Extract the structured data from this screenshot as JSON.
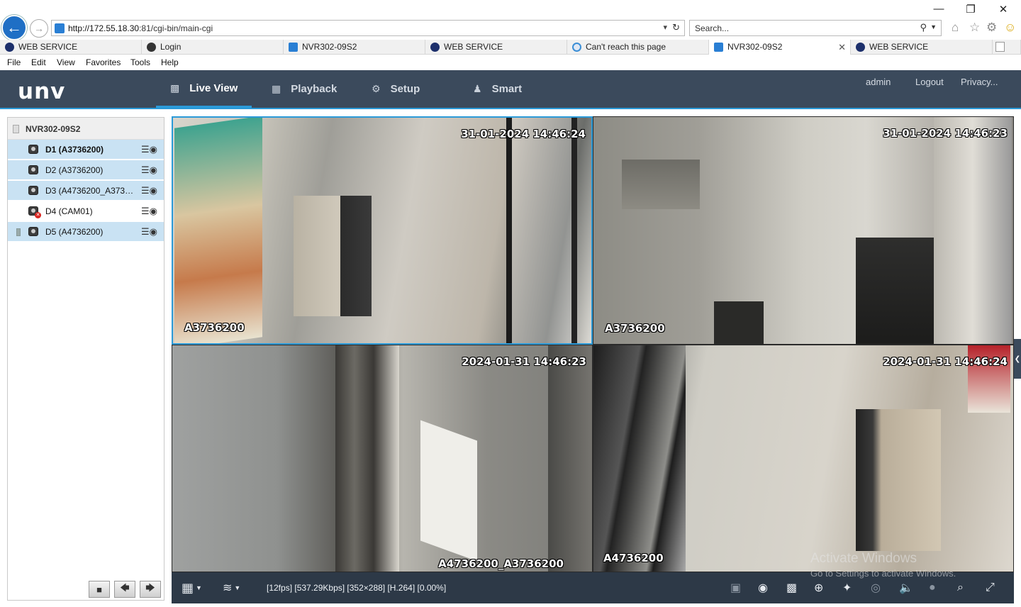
{
  "browser": {
    "url_host": "http://172.55.18.30",
    "url_rest": ":81/cgi-bin/main-cgi",
    "search_placeholder": "Search...",
    "tabs": [
      {
        "label": "WEB SERVICE",
        "icon": "globe-icon",
        "active": false
      },
      {
        "label": "Login",
        "icon": "globe-icon",
        "active": false
      },
      {
        "label": "NVR302-09S2",
        "icon": "page-icon",
        "active": false
      },
      {
        "label": "WEB SERVICE",
        "icon": "globe-icon",
        "active": false
      },
      {
        "label": "Can't reach this page",
        "icon": "ie-icon",
        "active": false
      },
      {
        "label": "NVR302-09S2",
        "icon": "page-icon",
        "active": true
      },
      {
        "label": "WEB SERVICE",
        "icon": "globe-icon",
        "active": false
      }
    ],
    "menu": [
      "File",
      "Edit",
      "View",
      "Favorites",
      "Tools",
      "Help"
    ]
  },
  "app": {
    "logo": "unv",
    "nav": [
      {
        "label": "Live View",
        "icon": "monitor-icon",
        "active": true
      },
      {
        "label": "Playback",
        "icon": "film-icon",
        "active": false
      },
      {
        "label": "Setup",
        "icon": "gear-icon",
        "active": false
      },
      {
        "label": "Smart",
        "icon": "person-icon",
        "active": false
      }
    ],
    "user": "admin",
    "logout": "Logout",
    "privacy": "Privacy..."
  },
  "sidebar": {
    "device": "NVR302-09S2",
    "cameras": [
      {
        "label": "D1 (A3736200)",
        "selected": true,
        "bold": true,
        "error": false
      },
      {
        "label": "D2 (A3736200)",
        "selected": true,
        "bold": false,
        "error": false
      },
      {
        "label": "D3 (A4736200_A3736200)",
        "selected": true,
        "bold": false,
        "error": false
      },
      {
        "label": "D4 (CAM01)",
        "selected": false,
        "bold": false,
        "error": true
      },
      {
        "label": "D5 (A4736200)",
        "selected": true,
        "bold": false,
        "error": false
      }
    ],
    "controls": [
      "stop-icon",
      "prev-icon",
      "next-icon"
    ]
  },
  "video": {
    "tiles": [
      {
        "timestamp": "31-01-2024 14:46:24",
        "osd": "A3736200"
      },
      {
        "timestamp": "31-01-2024 14:46:23",
        "osd": "A3736200"
      },
      {
        "timestamp": "2024-01-31 14:46:23",
        "osd": "A4736200_A3736200"
      },
      {
        "timestamp": "2024-01-31 14:46:24",
        "osd": "A4736200"
      }
    ]
  },
  "toolbar": {
    "stream_info": "[12fps] [537.29Kbps] [352×288] [H.264] [0.00%]",
    "buttons": [
      "layout-grid-icon",
      "stream-icon",
      "screen-icon",
      "snapshot-icon",
      "clip-icon",
      "zoom-icon",
      "ptz-icon",
      "focus-icon",
      "volume-icon",
      "mic-icon",
      "3d-zoom-icon",
      "fullscreen-icon"
    ]
  },
  "watermark": {
    "line1": "Activate Windows",
    "line2": "Go to Settings to activate Windows."
  },
  "colors": {
    "header_bg": "#3b4a5c",
    "accent": "#2b9ad8",
    "selected_row": "#c9e2f3",
    "toolbar_bg": "#2d3947"
  }
}
